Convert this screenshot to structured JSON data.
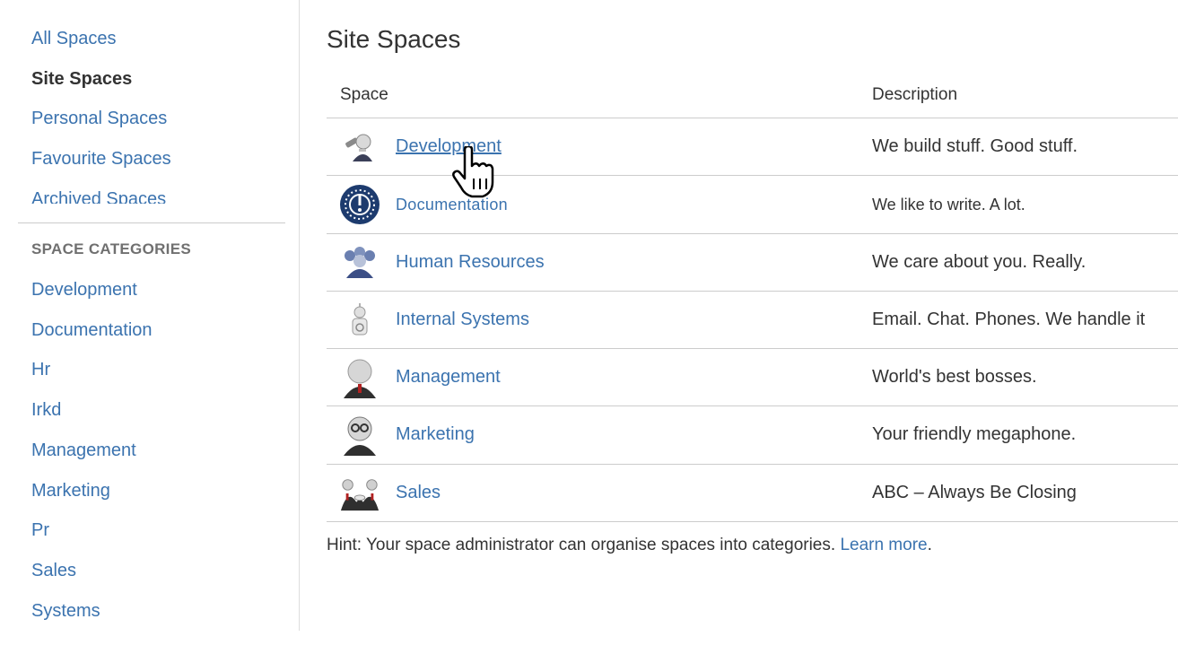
{
  "sidebar": {
    "nav": [
      {
        "label": "All Spaces",
        "active": false
      },
      {
        "label": "Site Spaces",
        "active": true
      },
      {
        "label": "Personal Spaces",
        "active": false
      },
      {
        "label": "Favourite Spaces",
        "active": false
      },
      {
        "label": "Archived Spaces",
        "active": false
      }
    ],
    "categories_heading": "SPACE CATEGORIES",
    "categories": [
      "Development",
      "Documentation",
      "Hr",
      "Irkd",
      "Management",
      "Marketing",
      "Pr",
      "Sales",
      "Systems"
    ]
  },
  "main": {
    "title": "Site Spaces",
    "columns": {
      "space": "Space",
      "description": "Description"
    },
    "rows": [
      {
        "name": "Development",
        "description": "We build stuff. Good stuff.",
        "icon": "development-avatar-icon"
      },
      {
        "name": "Documentation",
        "description": "We like to write. A lot.",
        "icon": "documentation-clock-icon"
      },
      {
        "name": "Human Resources",
        "description": "We care about you. Really.",
        "icon": "human-resources-group-icon"
      },
      {
        "name": "Internal Systems",
        "description": "Email. Chat. Phones. We handle it",
        "icon": "internal-systems-robot-icon"
      },
      {
        "name": "Management",
        "description": "World's best bosses.",
        "icon": "management-avatar-icon"
      },
      {
        "name": "Marketing",
        "description": "Your friendly megaphone.",
        "icon": "marketing-avatar-icon"
      },
      {
        "name": "Sales",
        "description": "ABC – Always Be Closing",
        "icon": "sales-handshake-icon"
      }
    ],
    "hint_text": "Hint: Your space administrator can organise spaces into categories. ",
    "hint_link": "Learn more",
    "hint_end": "."
  },
  "colors": {
    "link": "#3b73af",
    "text": "#333333",
    "border": "#cccccc"
  }
}
